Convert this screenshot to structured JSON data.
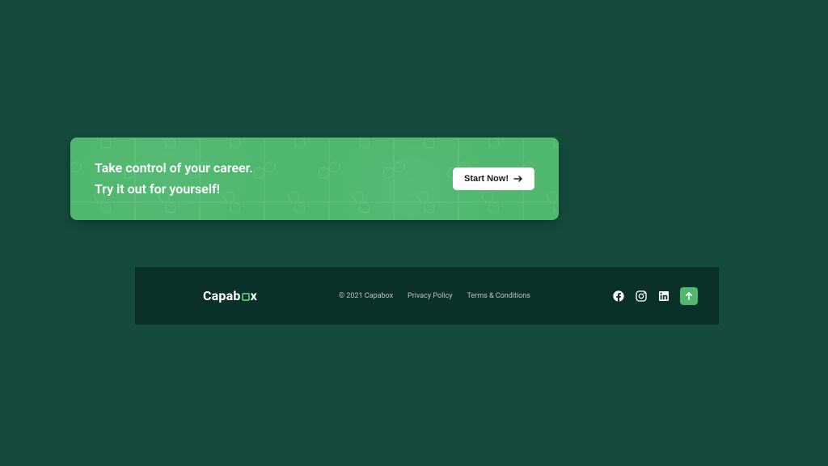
{
  "cta": {
    "headline_line1": "Take control of your career.",
    "headline_line2": "Try it out for yourself!",
    "button_label": "Start Now!"
  },
  "footer": {
    "logo_prefix": "Capab",
    "logo_suffix": "x",
    "copyright": "© 2021 Capabox",
    "privacy": "Privacy Policy",
    "terms": "Terms & Conditions"
  }
}
